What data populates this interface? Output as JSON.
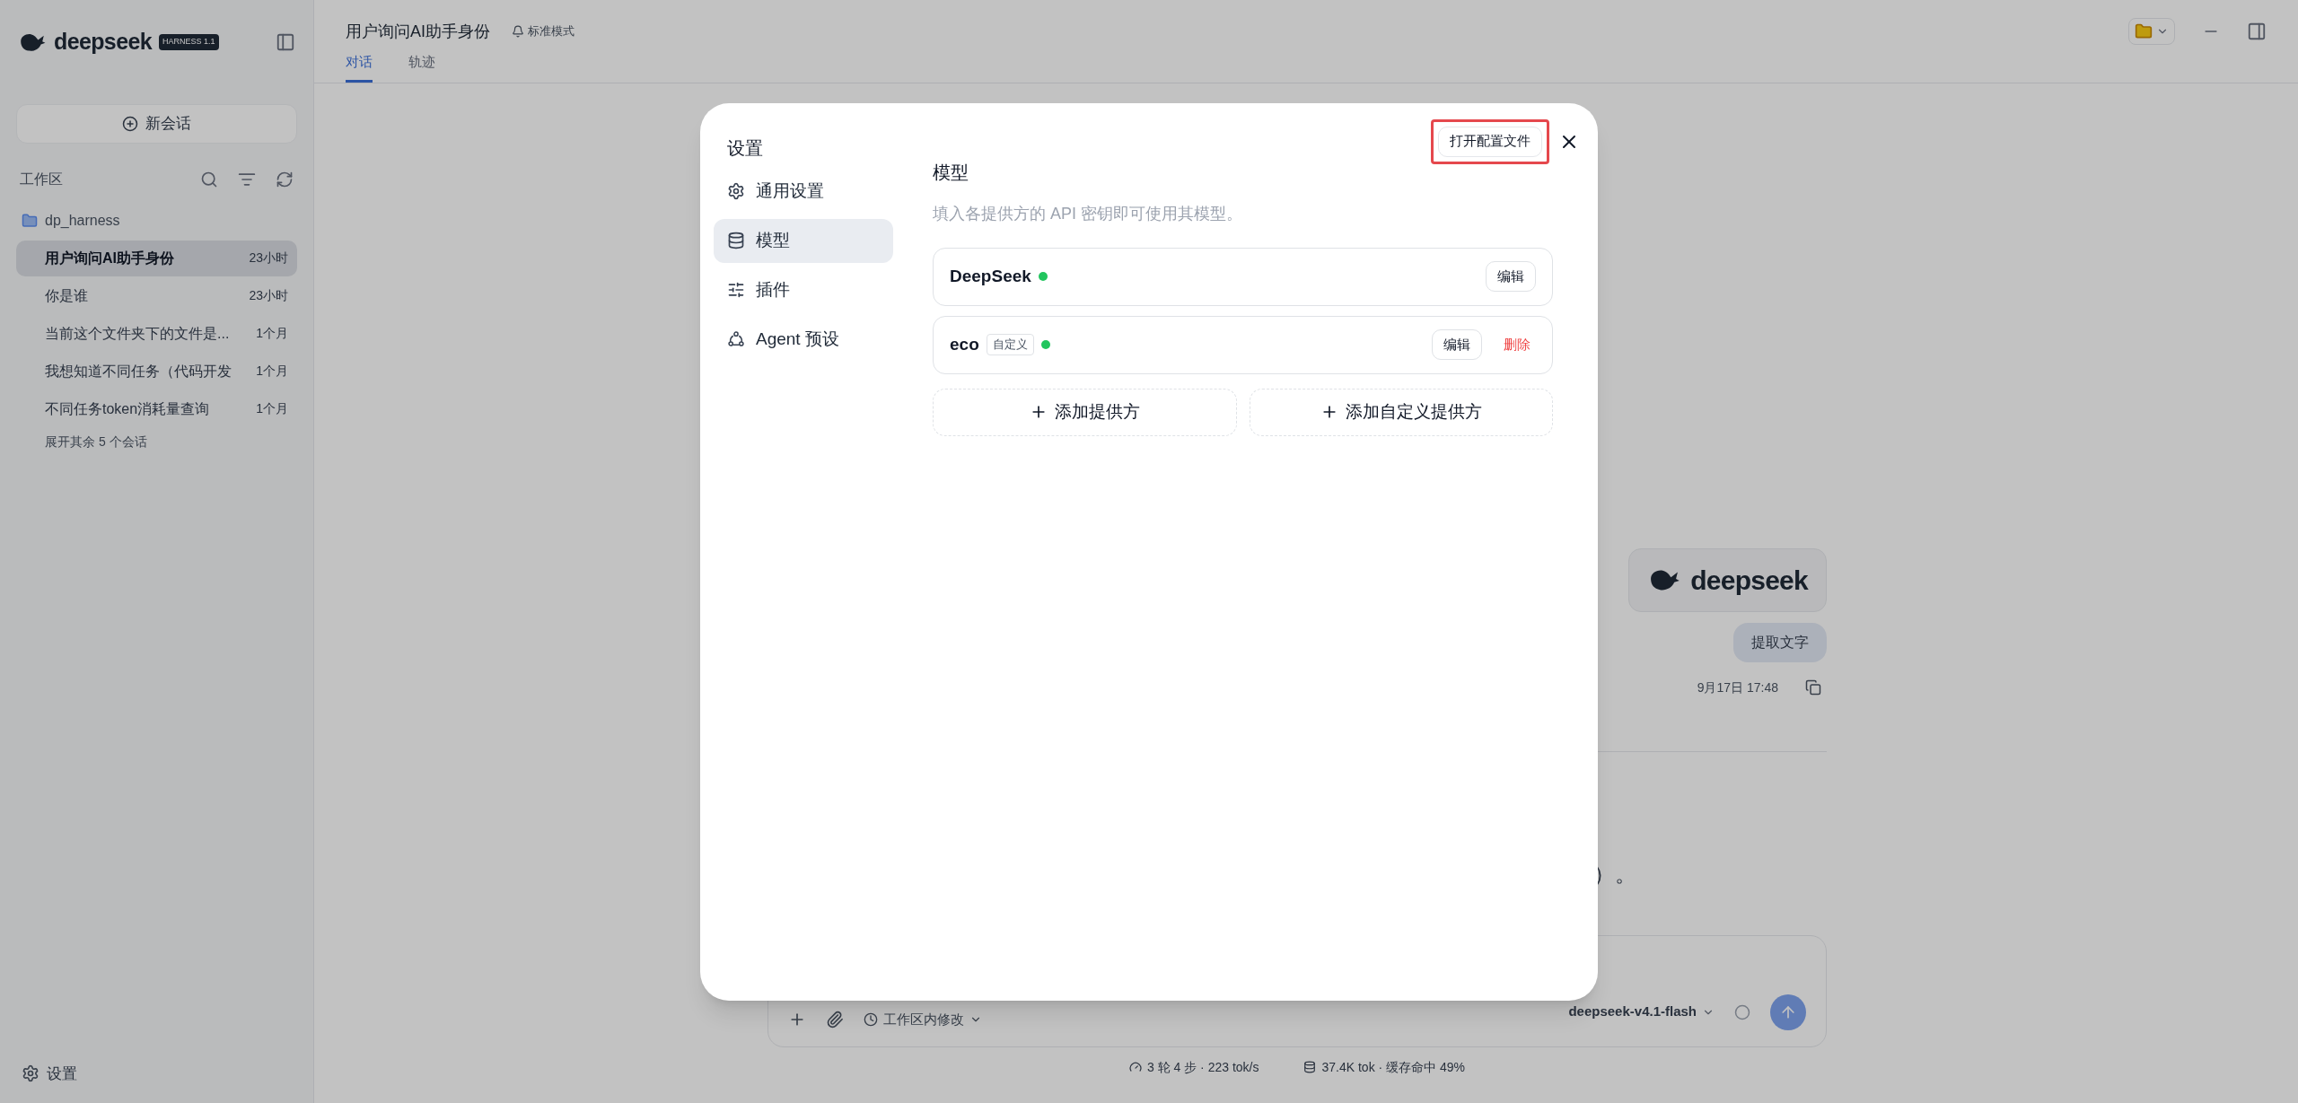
{
  "sidebar": {
    "logo": "deepseek",
    "badge": "HARNESS 1.1",
    "new_chat": "新会话",
    "workspace_label": "工作区",
    "folder": "dp_harness",
    "conversations": [
      {
        "title": "用户询问AI助手身份",
        "time": "23小时",
        "selected": true
      },
      {
        "title": "你是谁",
        "time": "23小时",
        "selected": false
      },
      {
        "title": "当前这个文件夹下的文件是...",
        "time": "1个月",
        "selected": false
      },
      {
        "title": "我想知道不同任务（代码开发",
        "time": "1个月",
        "selected": false
      },
      {
        "title": "不同任务token消耗量查询",
        "time": "1个月",
        "selected": false
      }
    ],
    "more": "展开其余 5 个会话",
    "settings": "设置"
  },
  "header": {
    "title": "用户询问AI助手身份",
    "mode": "标准模式",
    "tabs": [
      {
        "label": "对话",
        "selected": true
      },
      {
        "label": "轨迹",
        "selected": false
      }
    ]
  },
  "chat": {
    "image_text": "deepseek",
    "user_message": "提取文字",
    "timestamp": "9月17日 17:48",
    "partial_text": "）。"
  },
  "composer": {
    "mode": "工作区内修改",
    "model": "deepseek-v4.1-flash"
  },
  "status": {
    "left": "3 轮 4 步 · 223 tok/s",
    "right": "37.4K tok · 缓存命中 49%"
  },
  "dialog": {
    "title": "设置",
    "open_config": "打开配置文件",
    "nav": [
      {
        "label": "通用设置",
        "kind": "general",
        "selected": false
      },
      {
        "label": "模型",
        "kind": "model",
        "selected": true
      },
      {
        "label": "插件",
        "kind": "plugin",
        "selected": false
      },
      {
        "label": "Agent 预设",
        "kind": "agent",
        "selected": false
      }
    ],
    "section_title": "模型",
    "description": "填入各提供方的 API 密钥即可使用其模型。",
    "providers": [
      {
        "name": "DeepSeek",
        "connected": true,
        "actions": [
          {
            "label": "编辑",
            "kind": "edit"
          }
        ]
      },
      {
        "name": "eco",
        "tag": "自定义",
        "connected": true,
        "actions": [
          {
            "label": "编辑",
            "kind": "edit"
          },
          {
            "label": "删除",
            "kind": "delete"
          }
        ]
      }
    ],
    "add_buttons": [
      "添加提供方",
      "添加自定义提供方"
    ]
  }
}
